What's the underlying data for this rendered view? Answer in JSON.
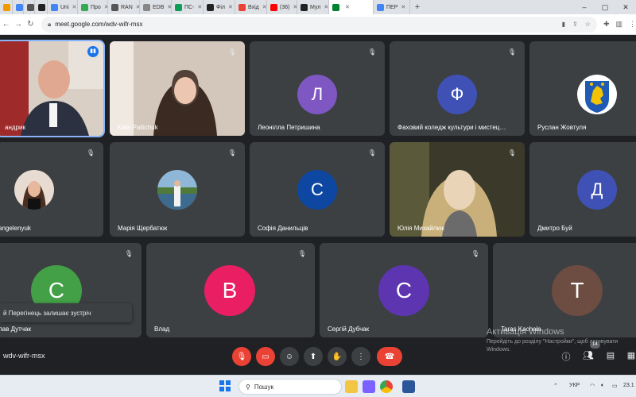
{
  "browser": {
    "tabs": [
      {
        "label": "",
        "color": "#f29900"
      },
      {
        "label": "",
        "color": "#4285f4"
      },
      {
        "label": "",
        "color": "#555555"
      },
      {
        "label": "",
        "color": "#222222"
      },
      {
        "label": "Uni",
        "color": "#4285f4"
      },
      {
        "label": "Про",
        "color": "#34a853"
      },
      {
        "label": "RAN",
        "color": "#555555"
      },
      {
        "label": "EDB",
        "color": "#888888"
      },
      {
        "label": "ПС-",
        "color": "#0f9d58"
      },
      {
        "label": "Філ",
        "color": "#222222"
      },
      {
        "label": "Вхід",
        "color": "#ea4335"
      },
      {
        "label": "(36)",
        "color": "#ff0000"
      },
      {
        "label": "Мул",
        "color": "#222222"
      },
      {
        "label": "",
        "color": "#00832d",
        "active": true
      },
      {
        "label": "ПЕР",
        "color": "#4285f4"
      }
    ],
    "new_tab": "+",
    "url": "meet.google.com/wdv-wifr-msx"
  },
  "meet": {
    "tiles": [
      {
        "name": "андрик",
        "type": "video",
        "speaking": true
      },
      {
        "name": "Kate Paliichuk",
        "type": "video"
      },
      {
        "name": "Леонілла Петришина",
        "initial": "Л",
        "color": "#7e57c2"
      },
      {
        "name": "Фаховий коледж культури і мистец…",
        "initial": "Ф",
        "color": "#3f51b5"
      },
      {
        "name": "Руслан Жовтуля",
        "type": "crest"
      },
      {
        "name": "angelenyuk",
        "type": "photo"
      },
      {
        "name": "Марія Щербатюк",
        "type": "photo"
      },
      {
        "name": "Софія Данильців",
        "initial": "С",
        "color": "#0d47a1"
      },
      {
        "name": "Юлія Михайлюк",
        "type": "video"
      },
      {
        "name": "Дмитро Буй",
        "initial": "Д",
        "color": "#3f51b5"
      },
      {
        "name": "лав Дутчак",
        "initial": "С",
        "color": "#43a047"
      },
      {
        "name": "Влад",
        "initial": "В",
        "color": "#e91e63"
      },
      {
        "name": "Сергій Дубчак",
        "initial": "С",
        "color": "#5e35b1"
      },
      {
        "name": "Taras Kachala",
        "initial": "T",
        "color": "#6d4c41"
      }
    ],
    "toast": "й Перегінець залишає зустріч",
    "meeting_code": "wdv-wifr-msx",
    "participant_count": "14",
    "watermark_title": "Активація Windows",
    "watermark_text": "Перейдіть до розділу \"Настройки\", щоб активувати Windows."
  },
  "taskbar": {
    "search_placeholder": "Пошук",
    "lang": "УКР",
    "time": "23.1"
  }
}
